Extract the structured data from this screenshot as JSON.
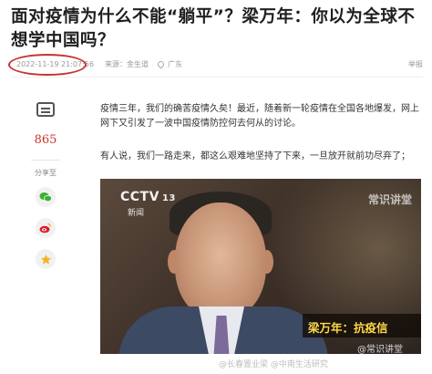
{
  "article": {
    "title": "面对疫情为什么不能“躺平”？梁万年：你以为全球不想学中国吗？",
    "timestamp": "2022-11-19 21:07:56",
    "source": "来源：金生道",
    "location": "广东",
    "report_label": "举报"
  },
  "sidebar": {
    "comment_count": "865",
    "share_label": "分享至",
    "share_targets": [
      "wechat-icon",
      "weibo-icon",
      "star-icon"
    ]
  },
  "content": {
    "paragraph_1": "疫情三年，我们的确苦疫情久矣！最近，随着新一轮疫情在全国各地爆发，网上网下又引发了一波中国疫情防控何去何从的讨论。",
    "paragraph_2": "有人说，我们一路走来，都这么艰难地坚持了下来，一旦放开就前功尽弃了；"
  },
  "video": {
    "channel_logo": "CCTV",
    "channel_number": "13",
    "channel_sub": "新闻",
    "top_watermark": "常识讲堂",
    "caption": "梁万年：抗疫信",
    "bottom_watermark": "@常识讲堂"
  },
  "footer": {
    "watermark": "@长春置业梁 @中南生活研究"
  },
  "colors": {
    "accent_red": "#c8332c",
    "caption_yellow": "#ffd84a"
  }
}
